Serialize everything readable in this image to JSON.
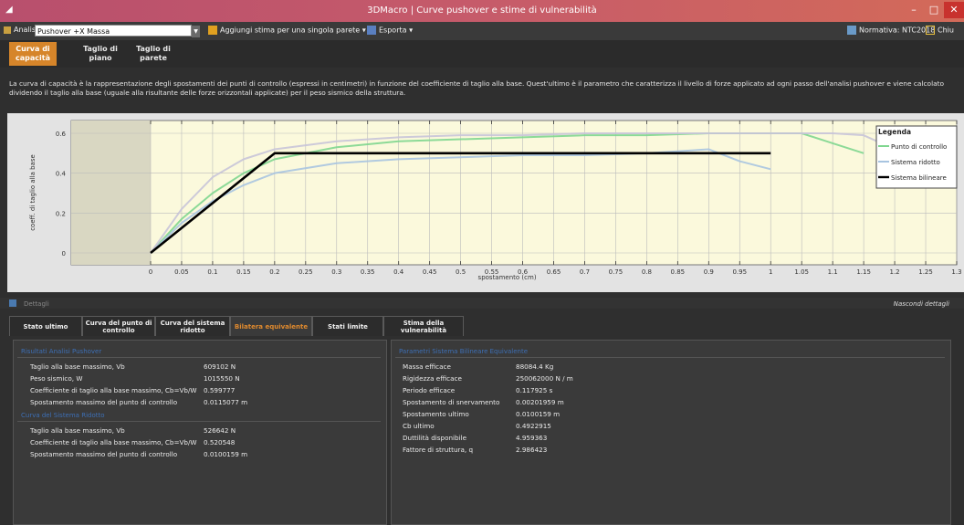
{
  "window": {
    "title": "3DMacro | Curve pushover e stime di vulnerabilità"
  },
  "toolbar": {
    "analysis_label": "Analisi",
    "analysis_value": "Pushover +X Massa",
    "add_estimate": "Aggiungi stima per una singola parete",
    "export": "Esporta",
    "normativa": "Normativa: NTC2018",
    "close": "Chiu"
  },
  "top_tabs": [
    {
      "l1": "Curva di",
      "l2": "capacità",
      "active": true
    },
    {
      "l1": "Taglio di",
      "l2": "piano",
      "active": false
    },
    {
      "l1": "Taglio di",
      "l2": "parete",
      "active": false
    }
  ],
  "description": "La curva di capacità è la rappresentazione degli spostamenti dei punti di controllo (espressi in centimetri) in funzione del coefficiente di taglio alla base. Quest'ultimo è il parametro che caratterizza il livello di forze applicato ad ogni passo dell'analisi pushover e viene calcolato dividendo il taglio alla base (uguale alla risultante delle forze orizzontali applicate) per il peso sismico della struttura.",
  "chart_data": {
    "type": "line",
    "xlabel": "spostamento (cm)",
    "ylabel": "coeff. di taglio alla base",
    "xlim": [
      0,
      1.3
    ],
    "ylim": [
      0,
      0.6
    ],
    "x_ticks": [
      "0",
      "0.05",
      "0.1",
      "0.15",
      "0.2",
      "0.25",
      "0.3",
      "0.35",
      "0.4",
      "0.45",
      "0.5",
      "0.55",
      "0.6",
      "0.65",
      "0.7",
      "0.75",
      "0.8",
      "0.85",
      "0.9",
      "0.95",
      "1",
      "1.05",
      "1.1",
      "1.15",
      "1.2",
      "1.25",
      "1.3"
    ],
    "y_ticks": [
      "0",
      "0.2",
      "0.4",
      "0.6"
    ],
    "legend_title": "Legenda",
    "legend_position": "top-right",
    "series": [
      {
        "name": "Punto di controllo",
        "color": "#7fd68f",
        "x": [
          0,
          0.05,
          0.1,
          0.15,
          0.2,
          0.3,
          0.4,
          0.5,
          0.6,
          0.7,
          0.8,
          0.9,
          1.0,
          1.05,
          1.1,
          1.15
        ],
        "y": [
          0,
          0.17,
          0.3,
          0.4,
          0.47,
          0.53,
          0.56,
          0.57,
          0.58,
          0.59,
          0.59,
          0.6,
          0.6,
          0.6,
          0.55,
          0.5
        ]
      },
      {
        "name": "Sistema ridotto",
        "color": "#a8c4e0",
        "x": [
          0,
          0.05,
          0.1,
          0.15,
          0.2,
          0.3,
          0.4,
          0.5,
          0.6,
          0.7,
          0.8,
          0.9,
          0.95,
          1.0
        ],
        "y": [
          0,
          0.15,
          0.26,
          0.34,
          0.4,
          0.45,
          0.47,
          0.48,
          0.49,
          0.49,
          0.5,
          0.52,
          0.46,
          0.42
        ]
      },
      {
        "name": "",
        "color": "#c8c4d8",
        "x": [
          0,
          0.05,
          0.1,
          0.15,
          0.2,
          0.3,
          0.4,
          0.5,
          0.6,
          0.7,
          0.8,
          0.9,
          1.0,
          1.05,
          1.1,
          1.15,
          1.2
        ],
        "y": [
          0,
          0.22,
          0.38,
          0.47,
          0.52,
          0.56,
          0.58,
          0.59,
          0.59,
          0.6,
          0.6,
          0.6,
          0.6,
          0.6,
          0.6,
          0.59,
          0.52
        ]
      },
      {
        "name": "Sistema bilineare",
        "color": "#000000",
        "x": [
          0,
          0.2,
          1.0
        ],
        "y": [
          0,
          0.5,
          0.5
        ]
      }
    ]
  },
  "details": {
    "label": "Dettagli",
    "hide": "Nascondi dettagli"
  },
  "bottom_tabs": [
    {
      "l1": "Stato ultimo",
      "l2": "",
      "active": false
    },
    {
      "l1": "Curva del punto di",
      "l2": "controllo",
      "active": false
    },
    {
      "l1": "Curva del sistema",
      "l2": "ridotto",
      "active": false
    },
    {
      "l1": "Bilatera equivalente",
      "l2": "",
      "active": true
    },
    {
      "l1": "Stati limite",
      "l2": "",
      "active": false
    },
    {
      "l1": "Stima della",
      "l2": "vulnerabilità",
      "active": false
    }
  ],
  "left_panel": {
    "sect1": "Risultati Analisi Pushover",
    "rows1": [
      {
        "label": "Taglio alla base massimo, Vb",
        "value": "609102 N"
      },
      {
        "label": "Peso sismico, W",
        "value": "1015550 N"
      },
      {
        "label": "Coefficiente di taglio alla base massimo, Cb=Vb/W",
        "value": "0.599777"
      },
      {
        "label": "Spostamento massimo del punto di controllo",
        "value": "0.0115077 m"
      }
    ],
    "sect2": "Curva del Sistema Ridotto",
    "rows2": [
      {
        "label": "Taglio alla base massimo, Vb",
        "value": "526642 N"
      },
      {
        "label": "Coefficiente di taglio alla base massimo, Cb=Vb/W",
        "value": "0.520548"
      },
      {
        "label": "Spostamento massimo del punto di controllo",
        "value": "0.0100159 m"
      }
    ]
  },
  "right_panel": {
    "sect": "Parametri Sistema Bilineare Equivalente",
    "rows": [
      {
        "label": "Massa efficace",
        "value": "88084.4 Kg"
      },
      {
        "label": "Rigidezza efficace",
        "value": "250062000 N / m"
      },
      {
        "label": "Periodo efficace",
        "value": "0.117925 s"
      },
      {
        "label": "Spostamento di snervamento",
        "value": "0.00201959 m"
      },
      {
        "label": "Spostamento ultimo",
        "value": "0.0100159 m"
      },
      {
        "label": "Cb ultimo",
        "value": "0.4922915"
      },
      {
        "label": "Duttilità disponibile",
        "value": "4.959363"
      },
      {
        "label": "Fattore di struttura, q",
        "value": "2.986423"
      }
    ]
  },
  "colors": {
    "accent": "#d6852a",
    "section": "#3d6fb5"
  }
}
